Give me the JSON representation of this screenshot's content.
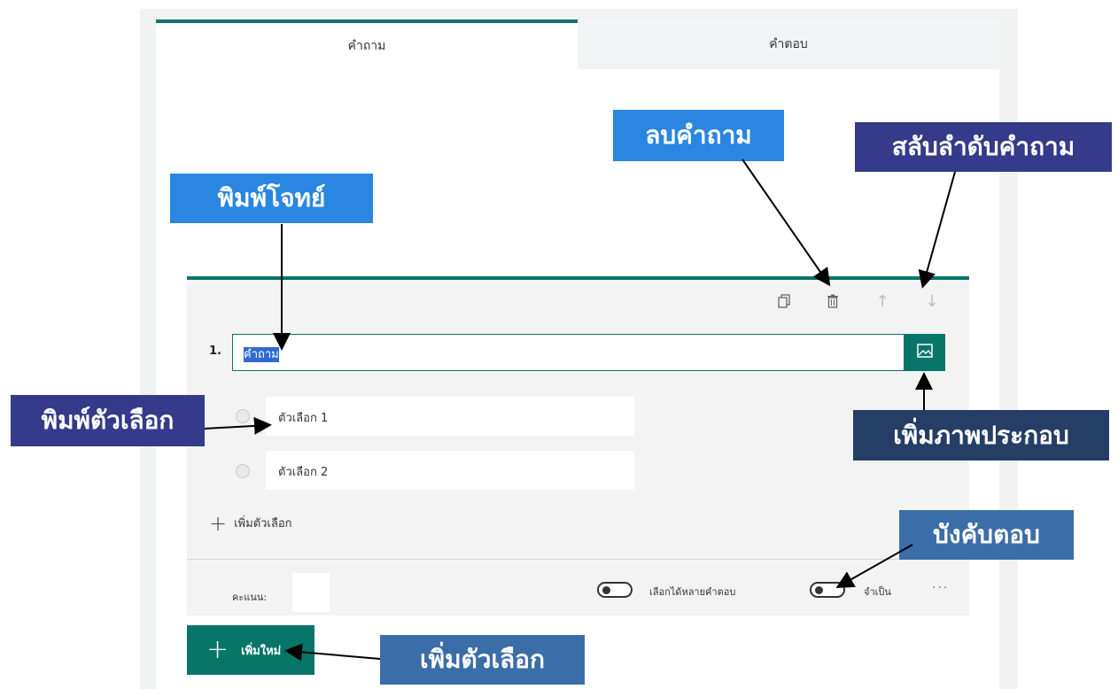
{
  "tabs": {
    "questions": "คำถาม",
    "responses": "คำตอบ"
  },
  "question": {
    "number": "1.",
    "title_value": "คำถาม",
    "options": [
      "ตัวเลือก 1",
      "ตัวเลือก 2"
    ],
    "add_option": "เพิ่มตัวเลือก"
  },
  "footer": {
    "points_label": "คะแนน:",
    "multiple_answers": "เลือกได้หลายคำตอบ",
    "required": "จำเป็น",
    "more": "···"
  },
  "add_new": {
    "plus": "+",
    "label": "เพิ่มใหม่"
  },
  "callouts": {
    "delete_question": "ลบคำถาม",
    "reorder_question": "สลับลำดับคำถาม",
    "type_question": "พิมพ์โจทย์",
    "type_option": "พิมพ์ตัวเลือก",
    "add_image": "เพิ่มภาพประกอบ",
    "required_answer": "บังคับตอบ",
    "add_option": "เพิ่มตัวเลือก"
  },
  "icons": {
    "copy": "copy-icon",
    "delete": "trash-icon",
    "up": "arrow-up-icon",
    "down": "arrow-down-icon",
    "image": "image-icon"
  },
  "colors": {
    "accent": "#077568",
    "callout_blue": "#2a86e0",
    "callout_navy": "#353a8a",
    "callout_dark": "#243e66",
    "callout_steel": "#3b6ea8"
  }
}
